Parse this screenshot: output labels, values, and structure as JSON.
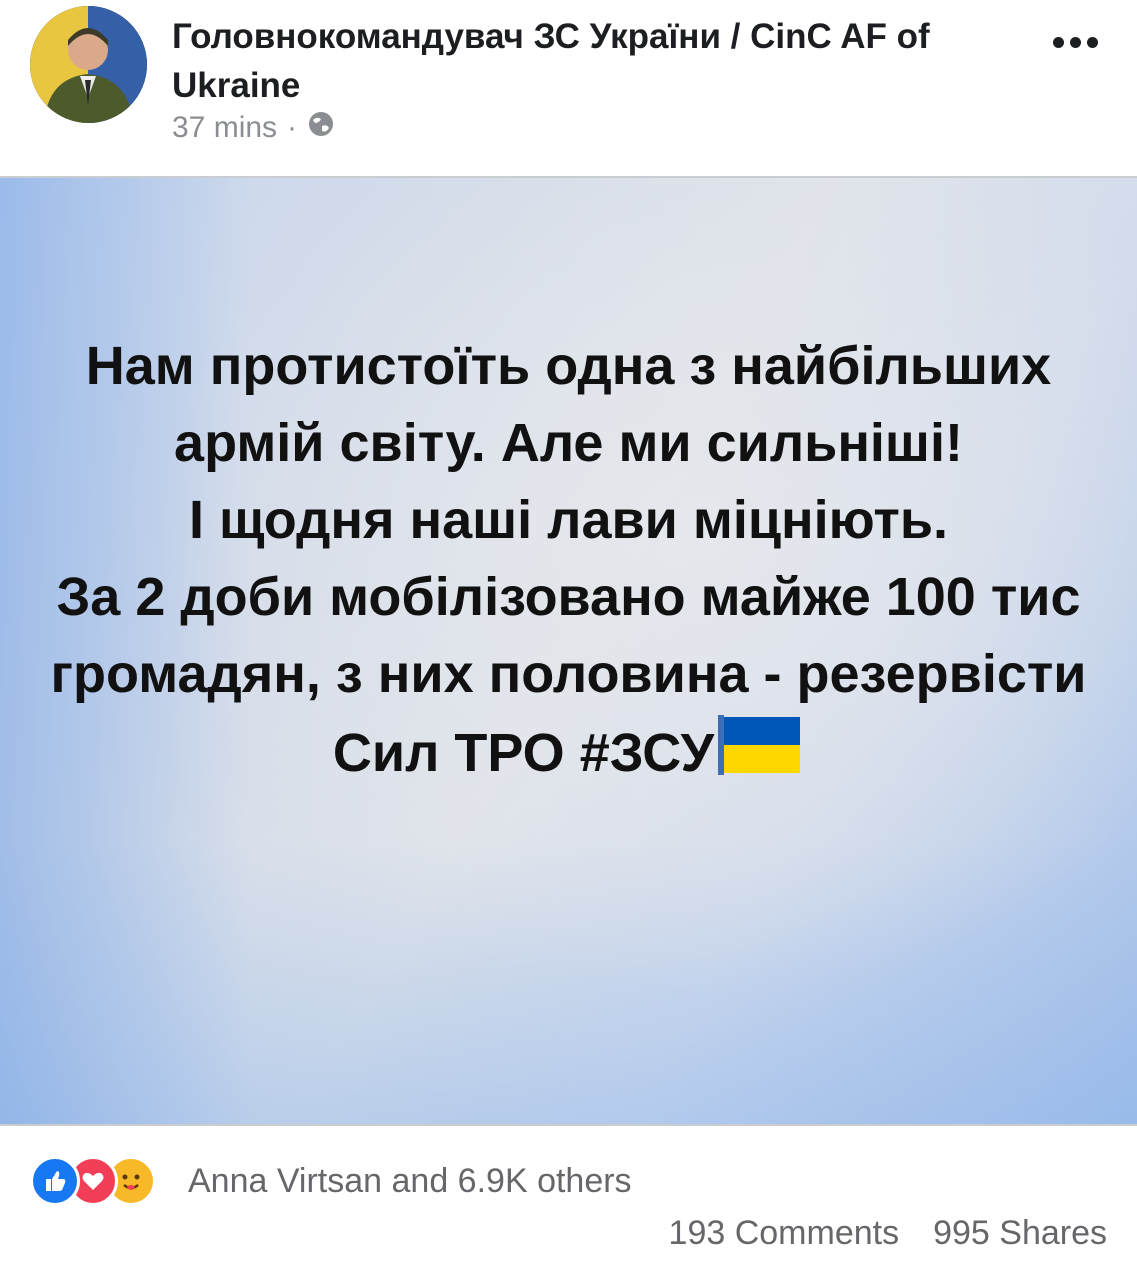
{
  "post": {
    "author": "Головнокомандувач ЗС України / CinC AF of Ukraine",
    "time": "37 mins",
    "separator": "·",
    "privacy_icon": "globe-icon",
    "more_icon": "more-options-icon"
  },
  "card": {
    "text_main": "Нам протистоїть одна з найбільших армій світу. Але ми сильніші!\nІ щодня наші лави міцніють.\nЗа 2 доби мобілізовано майже 100 тис громадян, з них половина - резервісти Сил ТРО #ЗСУ",
    "flag_emoji": "ukraine-flag-icon"
  },
  "footer": {
    "reactions": [
      "like-icon",
      "love-icon",
      "care-icon"
    ],
    "reaction_text": "Anna Virtsan and 6.9K others",
    "comments": "193 Comments",
    "shares": "995 Shares"
  },
  "colors": {
    "text_primary": "#1c1e21",
    "text_secondary": "#65676b",
    "like_blue": "#1877f2",
    "love_red": "#f33e58",
    "care_yellow": "#f7b928",
    "flag_blue": "#0057b7",
    "flag_yellow": "#ffd700"
  }
}
